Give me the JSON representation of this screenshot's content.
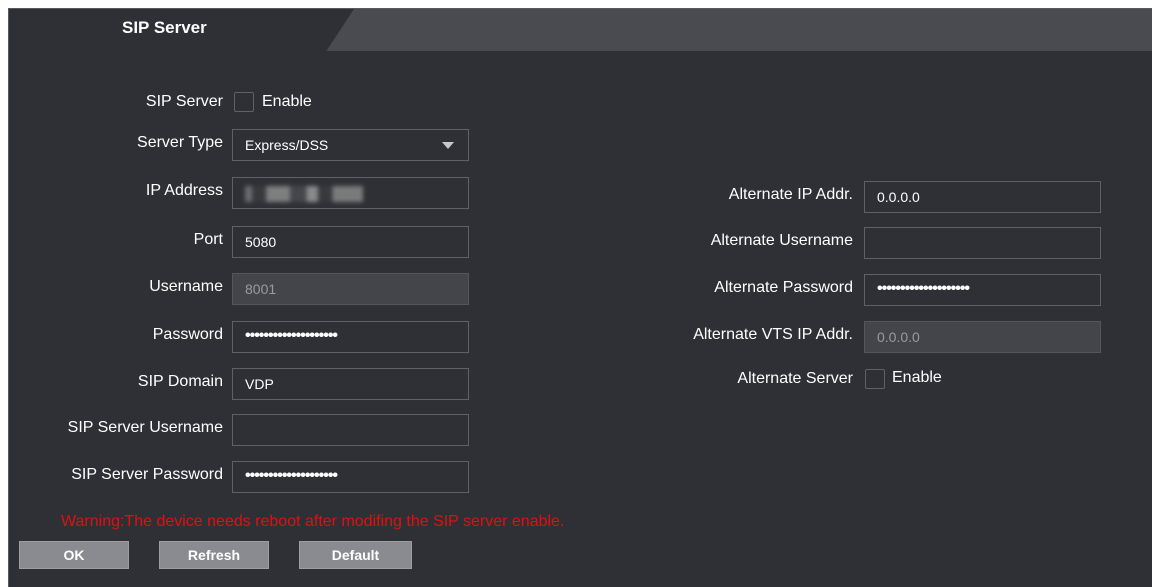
{
  "tabs": {
    "sip_server": "SIP Server"
  },
  "left": {
    "sip_server_label": "SIP Server",
    "sip_server_enable": "Enable",
    "server_type_label": "Server Type",
    "server_type_value": "Express/DSS",
    "ip_address_label": "IP Address",
    "port_label": "Port",
    "port_value": "5080",
    "username_label": "Username",
    "username_value": "8001",
    "password_label": "Password",
    "password_value": "••••••••••••••••••••",
    "sip_domain_label": "SIP Domain",
    "sip_domain_value": "VDP",
    "sip_server_username_label": "SIP Server Username",
    "sip_server_username_value": "",
    "sip_server_password_label": "SIP Server Password",
    "sip_server_password_value": "••••••••••••••••••••"
  },
  "right": {
    "alt_ip_label": "Alternate IP Addr.",
    "alt_ip_value": "0.0.0.0",
    "alt_username_label": "Alternate Username",
    "alt_username_value": "",
    "alt_password_label": "Alternate Password",
    "alt_password_value": "••••••••••••••••••••",
    "alt_vts_label": "Alternate VTS IP Addr.",
    "alt_vts_value": "0.0.0.0",
    "alt_server_label": "Alternate Server",
    "alt_server_enable": "Enable"
  },
  "warning": "Warning:The device needs reboot after modifing the SIP server enable.",
  "buttons": {
    "ok": "OK",
    "refresh": "Refresh",
    "default": "Default"
  },
  "colors": {
    "background": "#2f3035",
    "tabbar": "#4a4b50",
    "warning": "#e01010",
    "button": "#8a8b90"
  }
}
